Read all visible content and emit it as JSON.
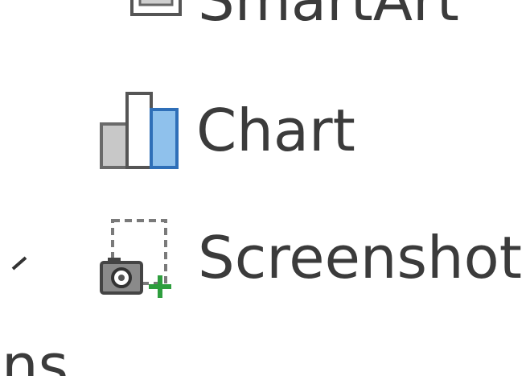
{
  "ribbon": {
    "items": [
      {
        "label": "SmartArt",
        "icon": "smartart-icon"
      },
      {
        "label": "Chart",
        "icon": "chart-icon"
      },
      {
        "label": "Screenshot",
        "icon": "screenshot-icon",
        "dropdown": true,
        "dropdown_icon": "chevron-down-icon"
      }
    ]
  },
  "left_fragments": {
    "bottom_text": "ns",
    "tick_icon": "chevron-down-icon"
  },
  "colors": {
    "text": "#3b3b3b",
    "chart_blue": "#4a90d9",
    "chart_gray": "#7a7a7a",
    "plus_green": "#2e9e3e"
  }
}
